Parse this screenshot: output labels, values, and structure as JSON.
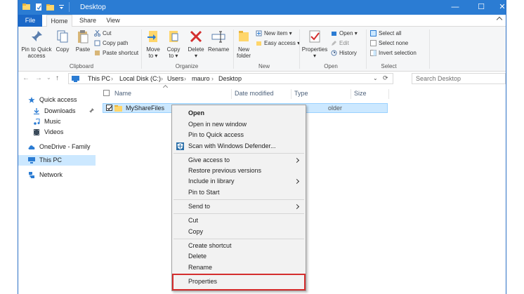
{
  "window": {
    "title": "Desktop",
    "controls": {
      "minimize": "—",
      "maximize": "☐",
      "close": "✕"
    }
  },
  "tabs": [
    {
      "label": "File"
    },
    {
      "label": "Home"
    },
    {
      "label": "Share"
    },
    {
      "label": "View"
    }
  ],
  "ribbon": {
    "clipboard": {
      "pin": "Pin to Quick",
      "pin2": "access",
      "copy": "Copy",
      "paste": "Paste",
      "cut": "Cut",
      "copy_path": "Copy path",
      "paste_shortcut": "Paste shortcut",
      "label": "Clipboard"
    },
    "organize": {
      "move": "Move",
      "move2": "to ▾",
      "copy": "Copy",
      "copy2": "to ▾",
      "delete": "Delete",
      "delete2": "▾",
      "rename": "Rename",
      "label": "Organize"
    },
    "new": {
      "new_folder": "New",
      "new_folder2": "folder",
      "new_item": "New item ▾",
      "easy_access": "Easy access ▾",
      "label": "New"
    },
    "open": {
      "properties": "Properties",
      "properties2": "▾",
      "open": "Open ▾",
      "edit": "Edit",
      "history": "History",
      "label": "Open"
    },
    "select": {
      "select_all": "Select all",
      "select_none": "Select none",
      "invert": "Invert selection",
      "label": "Select"
    }
  },
  "address": {
    "back": "←",
    "forward": "→",
    "recent": "⌄",
    "up": "↑",
    "crumbs": [
      "This PC",
      "›",
      "Local Disk (C:)",
      "›",
      "Users",
      "›",
      "mauro",
      "›",
      "Desktop"
    ],
    "chevron": "⌄",
    "refresh": "⟳",
    "search_placeholder": "Search Desktop"
  },
  "navpane": {
    "items": [
      {
        "label": "Quick access"
      },
      {
        "label": "Downloads"
      },
      {
        "label": "Music"
      },
      {
        "label": "Videos"
      },
      {
        "label": "OneDrive - Family"
      },
      {
        "label": "This PC"
      },
      {
        "label": "Network"
      }
    ]
  },
  "filelist": {
    "columns": [
      "Name",
      "Date modified",
      "Type",
      "Size"
    ],
    "rows": [
      {
        "name": "MyShareFiles",
        "type": "older"
      }
    ]
  },
  "context_menu": {
    "items": [
      "Open",
      "Open in new window",
      "Pin to Quick access",
      "Scan with Windows Defender...",
      "Give access to",
      "Restore previous versions",
      "Include in library",
      "Pin to Start",
      "Send to",
      "Cut",
      "Copy",
      "Create shortcut",
      "Delete",
      "Rename",
      "Properties"
    ]
  },
  "colors": {
    "titlebar": "#2b7cd3",
    "selection": "#cce8ff",
    "highlight": "#d42e2e"
  }
}
